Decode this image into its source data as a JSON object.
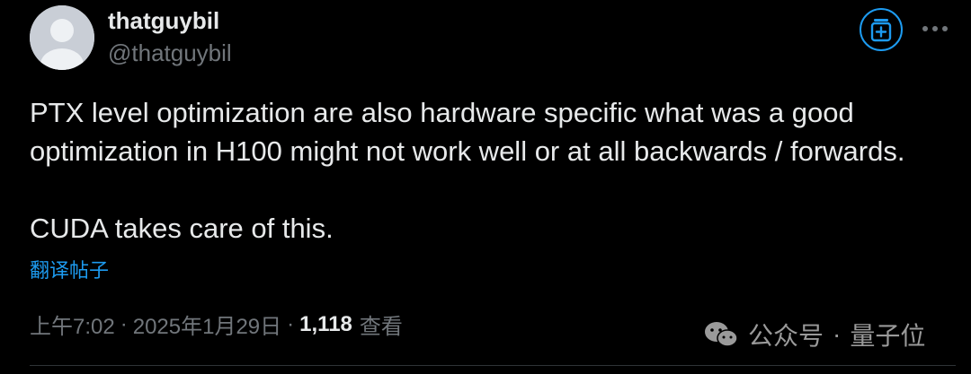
{
  "author": {
    "display_name": "thatguybil",
    "handle": "@thatguybil"
  },
  "header_actions": {
    "subscribe_icon": "subscribe-plus-icon",
    "more_icon": "more-dots-icon"
  },
  "tweet": {
    "lines": [
      "PTX level optimization are also hardware specific what was a good",
      "optimization in H100 might not work well or at all backwards / forwards.",
      "CUDA takes care of this."
    ],
    "translate_label": "翻译帖子"
  },
  "meta": {
    "time": "上午7:02",
    "separator": "·",
    "date": "2025年1月29日",
    "views_count": "1,118",
    "views_label": "查看"
  },
  "watermark": {
    "icon": "wechat-icon",
    "label": "公众号",
    "dot": "·",
    "account": "量子位"
  },
  "colors": {
    "background": "#000000",
    "text": "#e7e9ea",
    "secondary": "#71767b",
    "accent": "#1d9bf0"
  }
}
